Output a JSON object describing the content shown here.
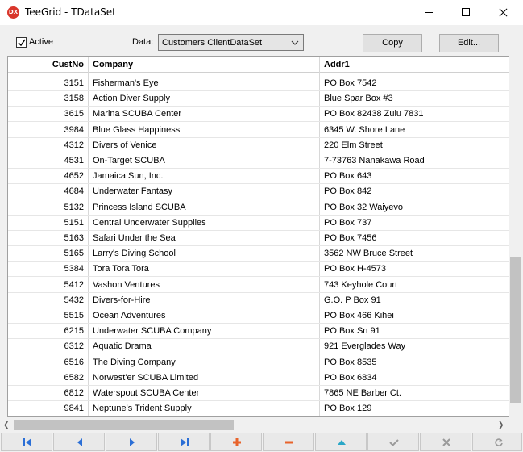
{
  "window": {
    "title": "TeeGrid - TDataSet",
    "app_icon_text": "DX"
  },
  "toolbar": {
    "active_label": "Active",
    "active_checked": true,
    "data_label": "Data:",
    "data_select_value": "Customers ClientDataSet",
    "copy_label": "Copy",
    "edit_label": "Edit..."
  },
  "grid": {
    "columns": [
      "CustNo",
      "Company",
      "Addr1"
    ],
    "rows": [
      [
        "3151",
        "Fisherman's Eye",
        "PO Box 7542"
      ],
      [
        "3158",
        "Action Diver Supply",
        "Blue Spar Box #3"
      ],
      [
        "3615",
        "Marina SCUBA Center",
        "PO Box 82438 Zulu 7831"
      ],
      [
        "3984",
        "Blue Glass Happiness",
        "6345 W. Shore Lane"
      ],
      [
        "4312",
        "Divers of Venice",
        "220 Elm Street"
      ],
      [
        "4531",
        "On-Target SCUBA",
        "7-73763 Nanakawa Road"
      ],
      [
        "4652",
        "Jamaica Sun, Inc.",
        "PO Box 643"
      ],
      [
        "4684",
        "Underwater Fantasy",
        "PO Box 842"
      ],
      [
        "5132",
        "Princess Island SCUBA",
        "PO Box 32 Waiyevo"
      ],
      [
        "5151",
        "Central Underwater Supplies",
        "PO Box 737"
      ],
      [
        "5163",
        "Safari Under the Sea",
        "PO Box 7456"
      ],
      [
        "5165",
        "Larry's Diving School",
        "3562 NW Bruce Street"
      ],
      [
        "5384",
        "Tora Tora Tora",
        "PO Box H-4573"
      ],
      [
        "5412",
        "Vashon Ventures",
        "743 Keyhole Court"
      ],
      [
        "5432",
        "Divers-for-Hire",
        "G.O. P Box 91"
      ],
      [
        "5515",
        "Ocean Adventures",
        "PO Box 466 Kihei"
      ],
      [
        "6215",
        "Underwater SCUBA Company",
        "PO Box Sn 91"
      ],
      [
        "6312",
        "Aquatic Drama",
        "921 Everglades Way"
      ],
      [
        "6516",
        "The Diving Company",
        "PO Box 8535"
      ],
      [
        "6582",
        "Norwest'er SCUBA Limited",
        "PO Box 6834"
      ],
      [
        "6812",
        "Waterspout SCUBA Center",
        "7865 NE Barber Ct."
      ],
      [
        "9841",
        "Neptune's Trident Supply",
        "PO Box 129"
      ]
    ]
  },
  "navigator": {
    "buttons": [
      "first-icon",
      "prior-icon",
      "next-icon",
      "last-icon",
      "insert-icon",
      "delete-icon",
      "edit-icon",
      "post-icon",
      "cancel-icon",
      "refresh-icon"
    ],
    "colors": {
      "blue": "#2b6fd6",
      "orange": "#e8632b",
      "teal": "#2aa7c7",
      "gray": "#9a9a9a"
    }
  }
}
